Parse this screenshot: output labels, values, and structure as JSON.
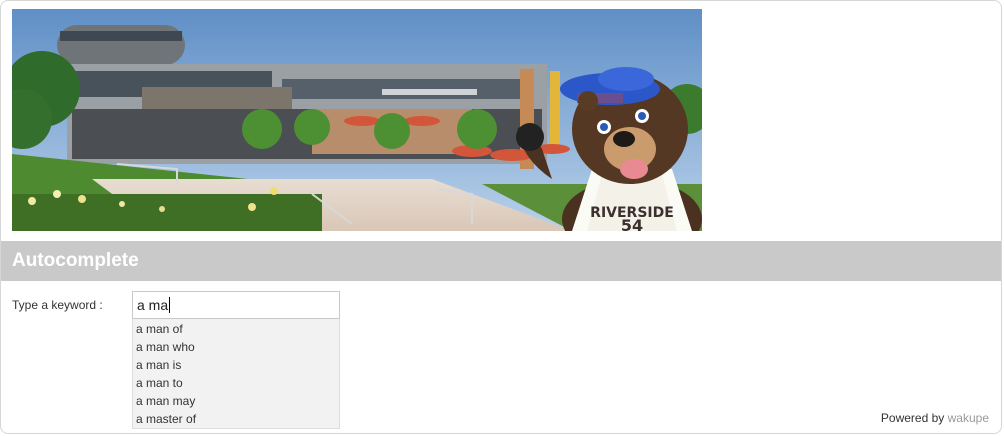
{
  "banner": {
    "sign_text": "RIVERSIDE",
    "sign_number": "54"
  },
  "section": {
    "title": "Autocomplete"
  },
  "search": {
    "label": "Type a keyword :",
    "value": "a ma"
  },
  "suggestions": [
    "a man of",
    "a man who",
    "a man is",
    "a man to",
    "a man may",
    "a master of"
  ],
  "footer": {
    "powered_by": "Powered by",
    "link_text": "wakupe"
  }
}
